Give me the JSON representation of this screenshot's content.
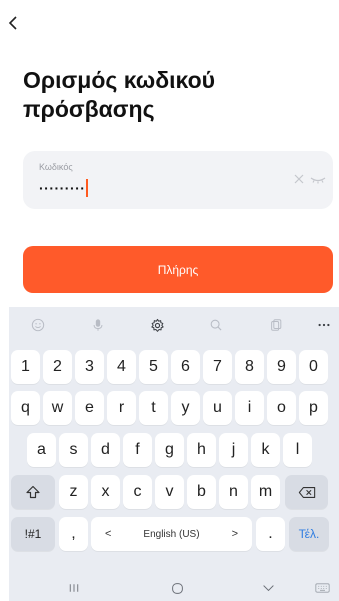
{
  "header": {
    "title": "Ορισμός κωδικού πρόσβασης"
  },
  "password": {
    "label": "Κωδικός",
    "masked_value": "·········"
  },
  "done_button": {
    "label": "Πλήρης"
  },
  "keyboard": {
    "number_row": [
      "1",
      "2",
      "3",
      "4",
      "5",
      "6",
      "7",
      "8",
      "9",
      "0"
    ],
    "row1": [
      "q",
      "w",
      "e",
      "r",
      "t",
      "y",
      "u",
      "i",
      "o",
      "p"
    ],
    "row2": [
      "a",
      "s",
      "d",
      "f",
      "g",
      "h",
      "j",
      "k",
      "l"
    ],
    "row3": [
      "z",
      "x",
      "c",
      "v",
      "b",
      "n",
      "m"
    ],
    "symbols_label": "!#1",
    "comma_label": ",",
    "space_label": "English (US)",
    "prev_lang": "<",
    "next_lang": ">",
    "period_label": ".",
    "go_label": "Τέλ."
  },
  "toolbar_icons": [
    "emoji-icon",
    "mic-icon",
    "gear-icon",
    "search-icon",
    "clipboard-icon",
    "more-icon"
  ],
  "colors": {
    "accent": "#ff5a2a",
    "caret": "#ff5a1f",
    "field_bg": "#f2f3f6",
    "keyboard_bg": "#e9ecf2",
    "go_key": "#2f7de1"
  }
}
